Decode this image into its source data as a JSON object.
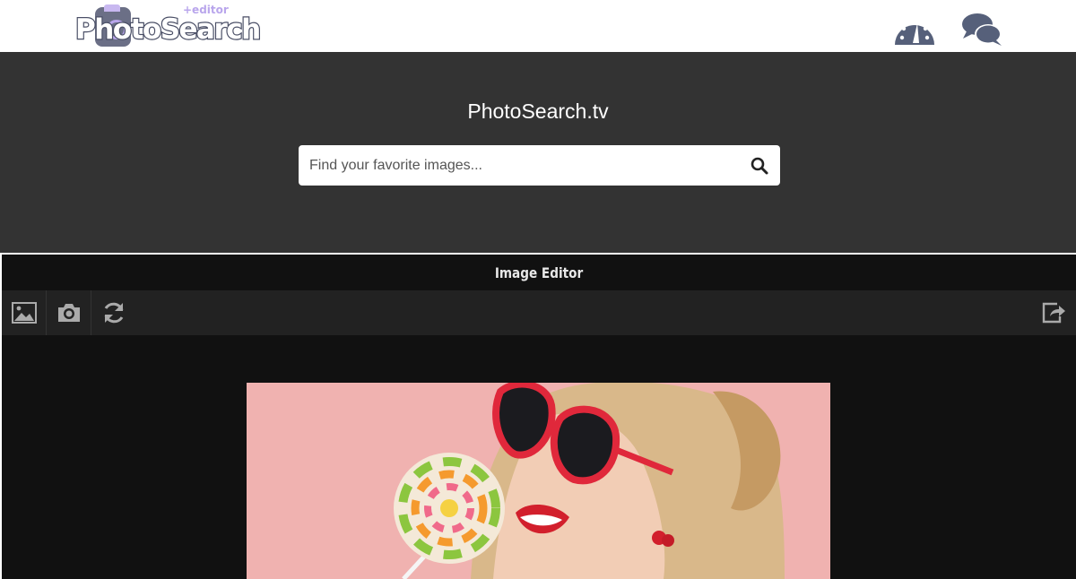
{
  "header": {
    "logo_text": "PhotoSearch",
    "logo_sup": "+editor",
    "icons": [
      "dashboard-icon",
      "chat-icon"
    ]
  },
  "hero": {
    "title": "PhotoSearch.tv",
    "search": {
      "placeholder": "Find your favorite images...",
      "value": "",
      "icon": "search-icon"
    }
  },
  "editor": {
    "title": "Image Editor",
    "tools": [
      "image-icon",
      "camera-icon",
      "refresh-icon"
    ],
    "share_icon": "share-icon"
  },
  "colors": {
    "hero_bg": "#333333",
    "editor_bg": "#111111",
    "toolbar_bg": "#222222",
    "icon_slate": "#56607a",
    "photo_bg": "#f0b2b0"
  }
}
